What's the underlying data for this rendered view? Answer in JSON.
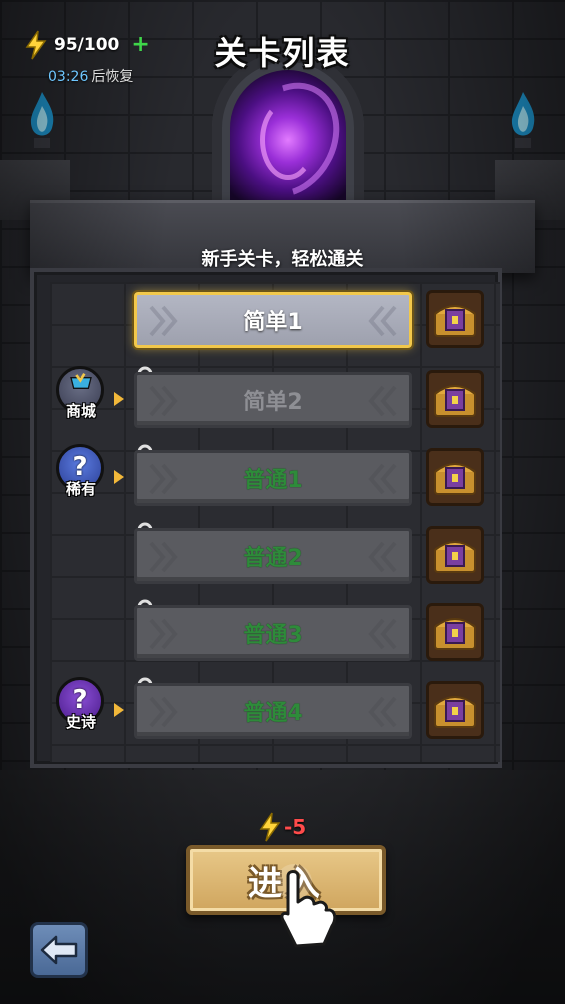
{
  "hud": {
    "energy_value": "95/100",
    "energy_plus": "+",
    "timer_time": "03:26",
    "timer_suffix": "后恢复"
  },
  "title": "关卡列表",
  "subtitle": "新手关卡，轻松通关",
  "levels": [
    {
      "label": "简单1",
      "locked": false,
      "selected": true,
      "difficulty": "easy"
    },
    {
      "label": "简单2",
      "locked": true,
      "selected": false,
      "difficulty": "easy"
    },
    {
      "label": "普通1",
      "locked": true,
      "selected": false,
      "difficulty": "normal"
    },
    {
      "label": "普通2",
      "locked": true,
      "selected": false,
      "difficulty": "normal"
    },
    {
      "label": "普通3",
      "locked": true,
      "selected": false,
      "difficulty": "normal"
    },
    {
      "label": "普通4",
      "locked": true,
      "selected": false,
      "difficulty": "normal"
    }
  ],
  "side_icons": {
    "shop": "商城",
    "rare": "稀有",
    "epic": "史诗",
    "question_mark": "?"
  },
  "enter": {
    "cost": "-5",
    "label": "进入"
  },
  "colors": {
    "accent_gold": "#f2c84b",
    "normal_green": "#2e8b3a",
    "cost_red": "#ff4b4b",
    "timer_blue": "#6ec7ff"
  },
  "icons": [
    "lightning-icon",
    "plus-icon",
    "lock-icon",
    "treasure-chest-icon",
    "shop-cart-icon",
    "question-icon",
    "back-arrow-icon",
    "hand-pointer-icon",
    "blue-flame-torch-icon",
    "portal-icon"
  ]
}
